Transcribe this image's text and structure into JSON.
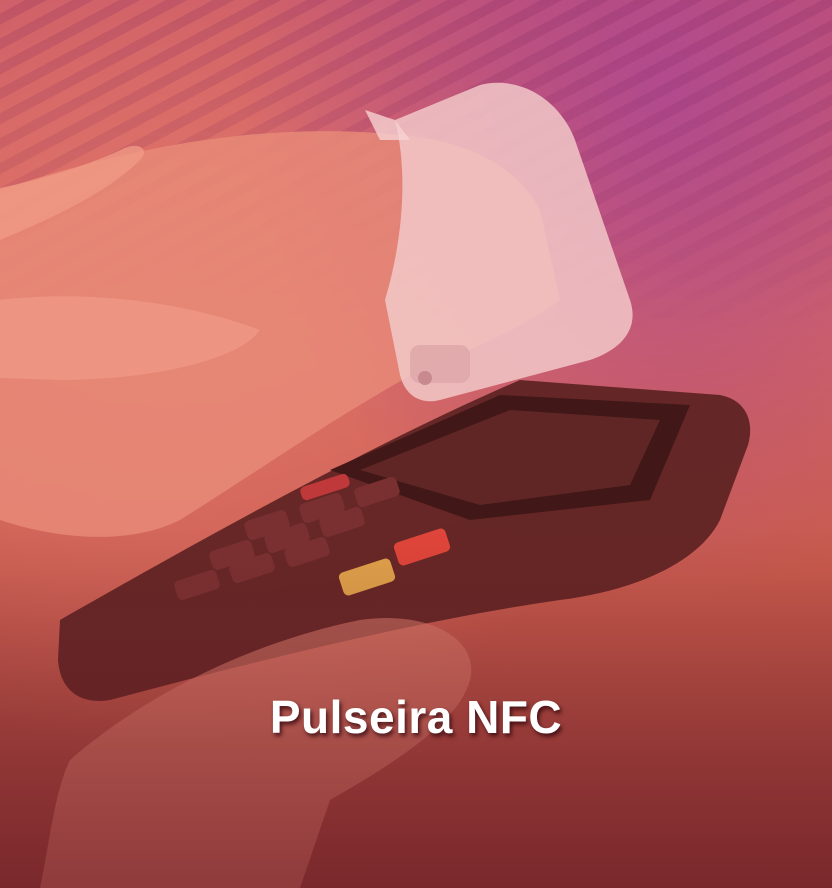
{
  "slide": {
    "title": "Pulseira NFC"
  },
  "colors": {
    "overlay_top": "#b14a8e",
    "overlay_mid": "#d86a5c",
    "overlay_bottom": "#8a3532",
    "title_text": "#ffffff"
  },
  "illustration": {
    "subject": "hand-with-smartwatch-tapping-payment-terminal",
    "icons": [
      "wristband-icon",
      "pos-terminal-icon"
    ]
  }
}
